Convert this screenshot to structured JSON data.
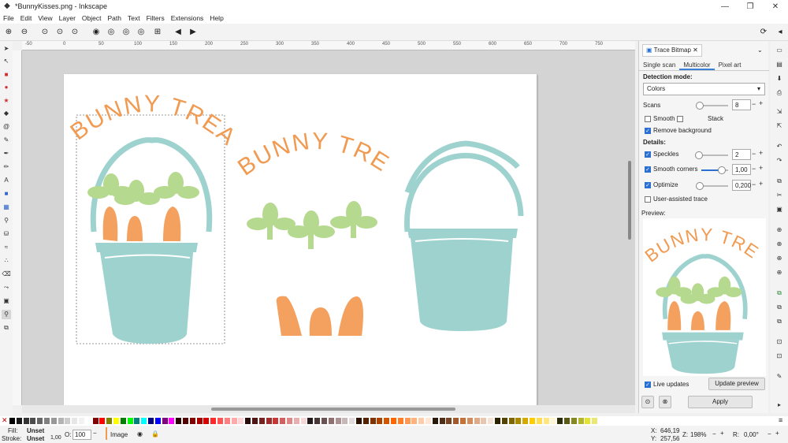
{
  "window": {
    "title": "*BunnyKisses.png - Inkscape",
    "minimize": "—",
    "maximize": "❐",
    "close": "✕"
  },
  "menu": [
    "File",
    "Edit",
    "View",
    "Layer",
    "Object",
    "Path",
    "Text",
    "Filters",
    "Extensions",
    "Help"
  ],
  "ruler_labels": [
    "-50",
    "0",
    "50",
    "100",
    "150",
    "200",
    "250",
    "300",
    "350",
    "400",
    "450",
    "500",
    "550",
    "600",
    "650",
    "700",
    "750"
  ],
  "canvas": {
    "artwork": {
      "arch_text": "BUNNY TREATS",
      "colors": {
        "orange": "#f4a160",
        "teal": "#9ed2cf",
        "green": "#b5d98e",
        "arch_text": "#f09a52"
      }
    }
  },
  "trace_panel": {
    "tab_label": "Trace Bitmap",
    "subtabs": [
      "Single scan",
      "Multicolor",
      "Pixel art"
    ],
    "detection_mode_label": "Detection mode:",
    "detection_mode_value": "Colors",
    "scans_label": "Scans",
    "scans_value": "8",
    "scans_level": 0.05,
    "smooth_label": "Smooth",
    "smooth_checked": false,
    "stack_label": "Stack",
    "stack_checked": false,
    "remove_bg_label": "Remove background",
    "remove_bg_checked": true,
    "details_label": "Details:",
    "speckles_label": "Speckles",
    "speckles_value": "2",
    "speckles_checked": true,
    "speckles_level": 0.02,
    "smooth_corners_label": "Smooth corners",
    "smooth_corners_value": "1,00",
    "smooth_corners_checked": true,
    "smooth_corners_level": 0.75,
    "optimize_label": "Optimize",
    "optimize_value": "0,200",
    "optimize_checked": true,
    "optimize_level": 0.04,
    "user_assisted_label": "User-assisted trace",
    "user_assisted_checked": false,
    "preview_label": "Preview:",
    "live_updates_label": "Live updates",
    "live_updates_checked": true,
    "update_preview_label": "Update preview",
    "apply_label": "Apply"
  },
  "status": {
    "fill_label": "Fill:",
    "fill_value": "Unset",
    "stroke_label": "Stroke:",
    "stroke_value": "Unset",
    "stroke_width": "1,00",
    "opacity_label": "O:",
    "opacity_value": "100",
    "layer_name": "Image",
    "x_label": "X:",
    "x_value": "646,19",
    "y_label": "Y:",
    "y_value": "257,56",
    "zoom_label": "Z:",
    "zoom_value": "198%",
    "rotation_label": "R:",
    "rotation_value": "0,00°"
  },
  "palette_colors": [
    "#000000",
    "#1a1a1a",
    "#333333",
    "#4d4d4d",
    "#666666",
    "#808080",
    "#999999",
    "#b3b3b3",
    "#cccccc",
    "#e6e6e6",
    "#f2f2f2",
    "#ffffff",
    "#800000",
    "#ff0000",
    "#808000",
    "#ffff00",
    "#008000",
    "#00ff00",
    "#008080",
    "#00ffff",
    "#000080",
    "#0000ff",
    "#800080",
    "#ff00ff",
    "#2b0000",
    "#550000",
    "#800000",
    "#aa0000",
    "#d40000",
    "#ff2a2a",
    "#ff5555",
    "#ff8080",
    "#ffaaaa",
    "#ffd5d5",
    "#280b0b",
    "#501616",
    "#782121",
    "#a02c2c",
    "#c83737",
    "#d35f5f",
    "#de8787",
    "#e9afaf",
    "#f4d7d7",
    "#241c1c",
    "#483737",
    "#6c5353",
    "#916f6f",
    "#ac9393",
    "#c8b7b7",
    "#e3dbdb",
    "#2b1100",
    "#552200",
    "#803300",
    "#aa4400",
    "#d45500",
    "#ff6600",
    "#ff7f2a",
    "#ff9955",
    "#ffb380",
    "#ffccaa",
    "#ffe6d5",
    "#28170b",
    "#502d16",
    "#784421",
    "#a05a2c",
    "#c87137",
    "#d38d5f",
    "#deaa87",
    "#e9c6af",
    "#f4e3d7",
    "#2b2200",
    "#554400",
    "#806600",
    "#aa8800",
    "#d4aa00",
    "#ffcc00",
    "#ffdd55",
    "#ffe680",
    "#fff6d5",
    "#2d2d0b",
    "#5a5a16",
    "#888821",
    "#b5b52c",
    "#e2e237",
    "#e8e872"
  ]
}
